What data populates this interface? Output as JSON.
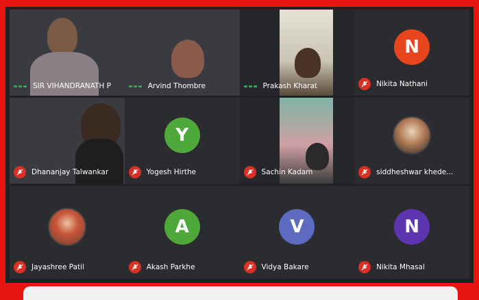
{
  "participants": [
    {
      "name": "SIR VIHANDRANATH P",
      "state": "speaking",
      "type": "video"
    },
    {
      "name": "Arvind Thombre",
      "state": "speaking",
      "type": "video"
    },
    {
      "name": "Prakash Kharat",
      "state": "speaking",
      "type": "video"
    },
    {
      "name": "Nikita Nathani",
      "state": "muted",
      "type": "avatar",
      "initial": "N",
      "color": "#e8451f"
    },
    {
      "name": "Dhananjay Talwankar",
      "state": "muted",
      "type": "video"
    },
    {
      "name": "Yogesh Hirthe",
      "state": "muted",
      "type": "avatar",
      "initial": "Y",
      "color": "#4fa83a"
    },
    {
      "name": "Sachin Kadam",
      "state": "muted",
      "type": "video"
    },
    {
      "name": "siddheshwar khede...",
      "state": "muted",
      "type": "photo"
    },
    {
      "name": "Jayashree Patil",
      "state": "muted",
      "type": "photo"
    },
    {
      "name": "Akash Parkhe",
      "state": "muted",
      "type": "avatar",
      "initial": "A",
      "color": "#4fa83a"
    },
    {
      "name": "Vidya Bakare",
      "state": "muted",
      "type": "avatar",
      "initial": "V",
      "color": "#5c6bc0"
    },
    {
      "name": "Nikita Mhasal",
      "state": "muted",
      "type": "avatar",
      "initial": "N",
      "color": "#5e35b1"
    }
  ],
  "colors": {
    "frame": "#e8140f",
    "background": "#202124",
    "mute": "#d93025",
    "speaking": "#34a853"
  }
}
